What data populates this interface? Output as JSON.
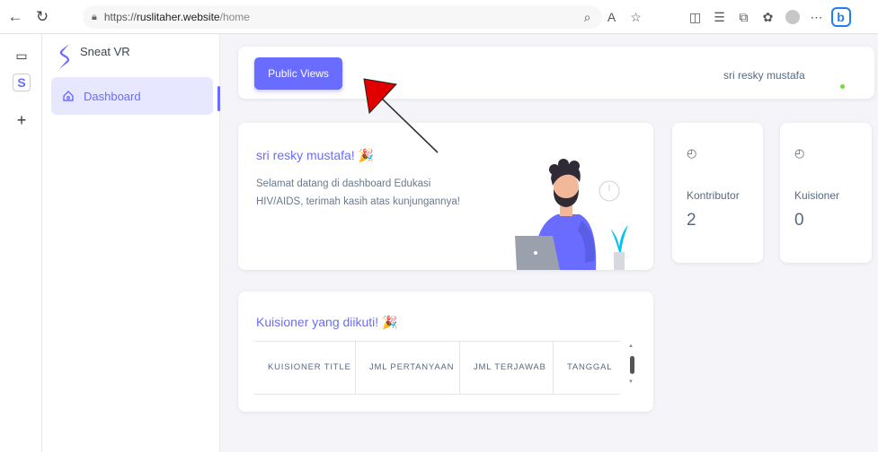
{
  "browser": {
    "url_prefix": "https://",
    "url_host": "ruslitaher.website",
    "url_path": "/home"
  },
  "app": {
    "brand": "Sneat VR",
    "menu_dashboard": "Dashboard",
    "accent": "#696cff"
  },
  "topnav": {
    "public_views_label": "Public Views",
    "user_name": "sri resky mustafa"
  },
  "welcome": {
    "title": "sri resky mustafa! 🎉",
    "text": "Selamat datang di dashboard Edukasi HIV/AIDS, terimah kasih atas kunjungannya!"
  },
  "stats": [
    {
      "label": "Kontributor",
      "value": "2",
      "icon": "stat-icon"
    },
    {
      "label": "Kuisioner",
      "value": "0",
      "icon": "stat-icon"
    }
  ],
  "kuisioner": {
    "title": "Kuisioner yang diikuti! 🎉",
    "columns": [
      "KUISIONER TITLE",
      "JML PERTANYAAN",
      "JML TERJAWAB",
      "TANGGAL"
    ]
  }
}
